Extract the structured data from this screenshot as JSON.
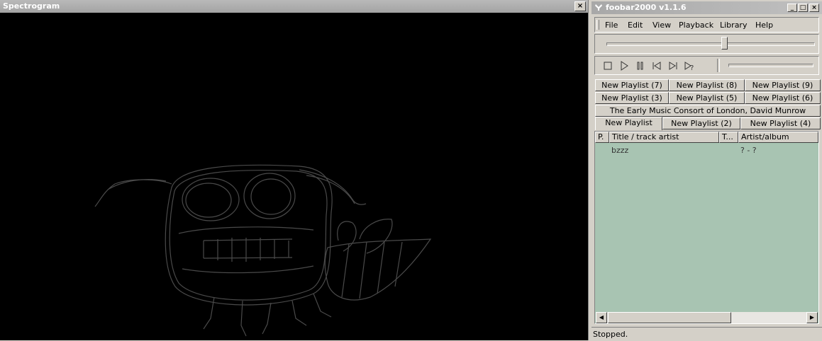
{
  "spectrogram": {
    "title": "Spectrogram",
    "close_label": "×"
  },
  "foobar": {
    "title": "foobar2000 v1.1.6",
    "window_buttons": {
      "minimize": "_",
      "maximize": "□",
      "close": "×"
    },
    "menu": [
      "File",
      "Edit",
      "View",
      "Playback",
      "Library",
      "Help"
    ],
    "seek_position": 0.57,
    "volume_level": 1.0,
    "toolbar_icons": [
      "stop-icon",
      "play-icon",
      "pause-icon",
      "previous-icon",
      "next-icon",
      "random-icon"
    ],
    "tab_rows": [
      [
        "New Playlist (7)",
        "New Playlist (8)",
        "New Playlist (9)"
      ],
      [
        "New Playlist (3)",
        "New Playlist (5)",
        "New Playlist (6)"
      ],
      [
        "The Early Music Consort of London, David Munrow"
      ],
      [
        "New Playlist",
        "New Playlist (2)",
        "New Playlist (4)"
      ]
    ],
    "active_tab": "New Playlist",
    "columns": [
      "P.",
      "Title / track artist",
      "T...",
      "Artist/album"
    ],
    "rows": [
      {
        "title": "bzzz",
        "artist_album": "? - ?"
      }
    ],
    "status": "Stopped.",
    "colors": {
      "playlist_bg": "#a8c4b2",
      "spectrogram_bg": "#000000",
      "drawing": "#4a4a4a"
    }
  }
}
